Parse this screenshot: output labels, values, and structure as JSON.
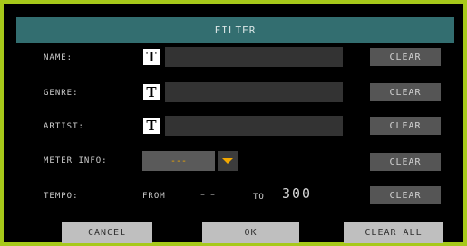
{
  "dialog": {
    "title": "FILTER"
  },
  "rows": {
    "name": {
      "label": "NAME:",
      "text_icon": "T",
      "value": "",
      "clear_label": "CLEAR"
    },
    "genre": {
      "label": "GENRE:",
      "text_icon": "T",
      "value": "",
      "clear_label": "CLEAR"
    },
    "artist": {
      "label": "ARTIST:",
      "text_icon": "T",
      "value": "",
      "clear_label": "CLEAR"
    },
    "meter_info": {
      "label": "METER INFO:",
      "selected": "---",
      "clear_label": "CLEAR"
    },
    "tempo": {
      "label": "TEMPO:",
      "from_label": "FROM",
      "from_value": "--",
      "to_label": "TO",
      "to_value": "300",
      "clear_label": "CLEAR"
    }
  },
  "footer": {
    "cancel_label": "CANCEL",
    "ok_label": "OK",
    "clear_all_label": "CLEAR ALL"
  },
  "colors": {
    "frame_border": "#a7c91a",
    "title_bar": "#336e70",
    "accent": "#f2a800",
    "field_bg": "#333333",
    "button_bg": "#555555"
  },
  "icons": {
    "text_edit": "text-edit-icon",
    "dropdown": "dropdown-arrow-icon"
  }
}
